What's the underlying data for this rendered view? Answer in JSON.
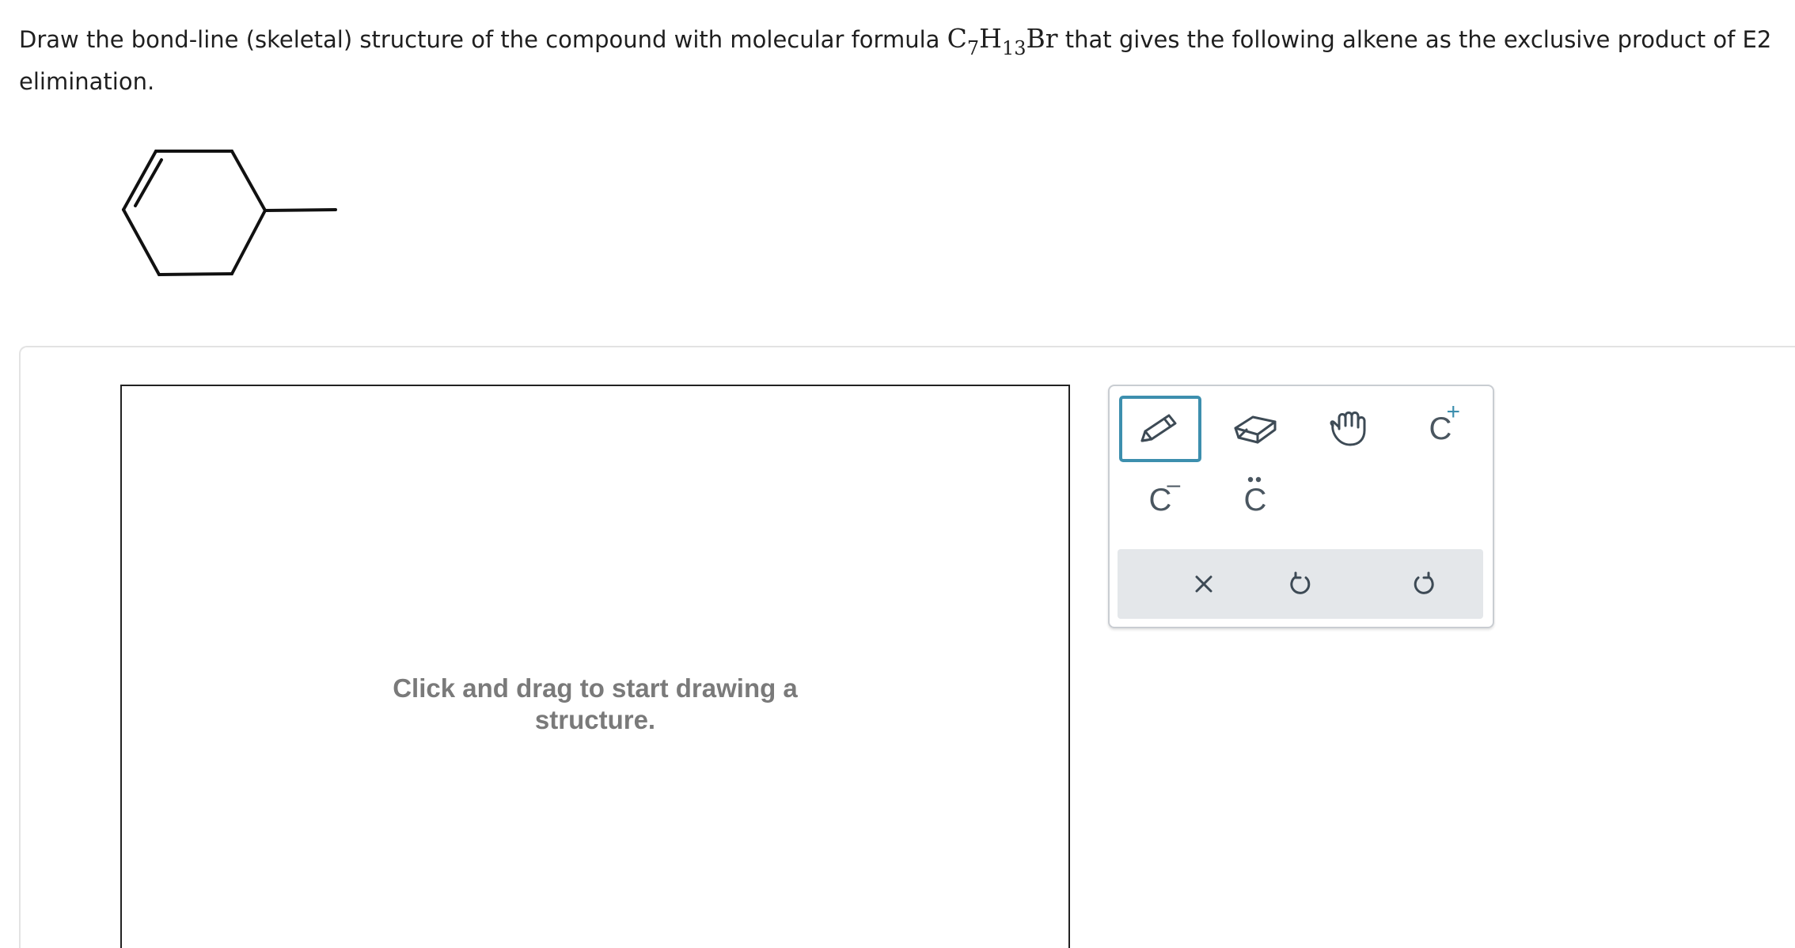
{
  "question": {
    "text_before": "Draw the bond-line (skeletal) structure of the compound with molecular formula ",
    "formula": {
      "c": "C",
      "c_count": "7",
      "h": "H",
      "h_count": "13",
      "br": "Br"
    },
    "text_after": " that gives the following alkene as the exclusive product of E2 elimination."
  },
  "molecule": {
    "name_icon": "3-methylcyclohexene-structure",
    "stroke_color": "#111111"
  },
  "canvas": {
    "hint_line1": "Click and drag to start drawing a",
    "hint_line2": "structure."
  },
  "toolbox": {
    "accent_color": "#3d8fae",
    "tools": [
      {
        "name": "pencil-icon",
        "active": true
      },
      {
        "name": "eraser-icon",
        "active": false
      },
      {
        "name": "hand-icon",
        "active": false
      }
    ],
    "charges": {
      "positive_atom": "C",
      "positive_sign": "+",
      "negative_atom": "C",
      "negative_sign": "–",
      "lone_pair_atom": "C"
    },
    "actions": [
      {
        "name": "clear-icon"
      },
      {
        "name": "undo-icon"
      },
      {
        "name": "redo-icon"
      }
    ]
  }
}
